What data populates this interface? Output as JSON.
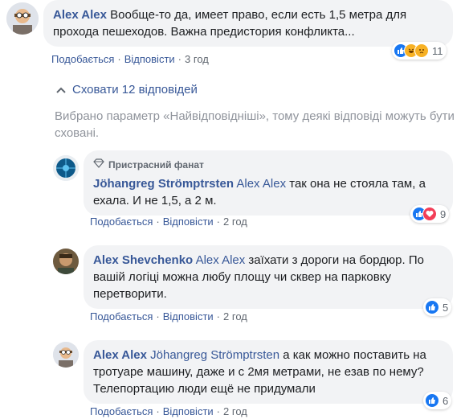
{
  "comments": [
    {
      "author": "Alex Alex",
      "text": "Вообще-то да, имеет право, если есть 1,5 метра для прохода пешеходов. Важна предистория конфликта...",
      "like_label": "Подобається",
      "reply_label": "Відповісти",
      "time": "3 год",
      "reaction_count": "11"
    }
  ],
  "replies_toggle": "Сховати 12 відповідей",
  "notice": "Вибрано параметр «Найвідповідніші», тому деякі відповіді можуть бути сховані.",
  "replies": [
    {
      "badge": "Пристрасний фанат",
      "author": "Jöhangreg Strömptrsten",
      "mention": "Alex Alex",
      "text": " так она не стояла там, а ехала. И не 1,5, а 2 м.",
      "like_label": "Подобається",
      "reply_label": "Відповісти",
      "time": "2 год",
      "reaction_count": "9"
    },
    {
      "author": "Alex Shevchenko",
      "mention": "Alex Alex",
      "text": " заїхати з дороги на бордюр. По вашій логіці можна любу площу чи сквер на парковку перетворити.",
      "like_label": "Подобається",
      "reply_label": "Відповісти",
      "time": "2 год",
      "reaction_count": "5"
    },
    {
      "author": "Alex Alex",
      "mention": "Jöhangreg Strömptrsten",
      "text": " а как можно поставить на тротуаре машину, даже и с 2мя метрами, не езав по нему? Телепортацию люди ещё не придумали",
      "like_label": "Подобається",
      "reply_label": "Відповісти",
      "time": "2 год",
      "reaction_count": "6"
    }
  ],
  "colors": {
    "link": "#385898",
    "like": "#1877f2",
    "love": "#f33e58",
    "haha": "#f7b125"
  }
}
